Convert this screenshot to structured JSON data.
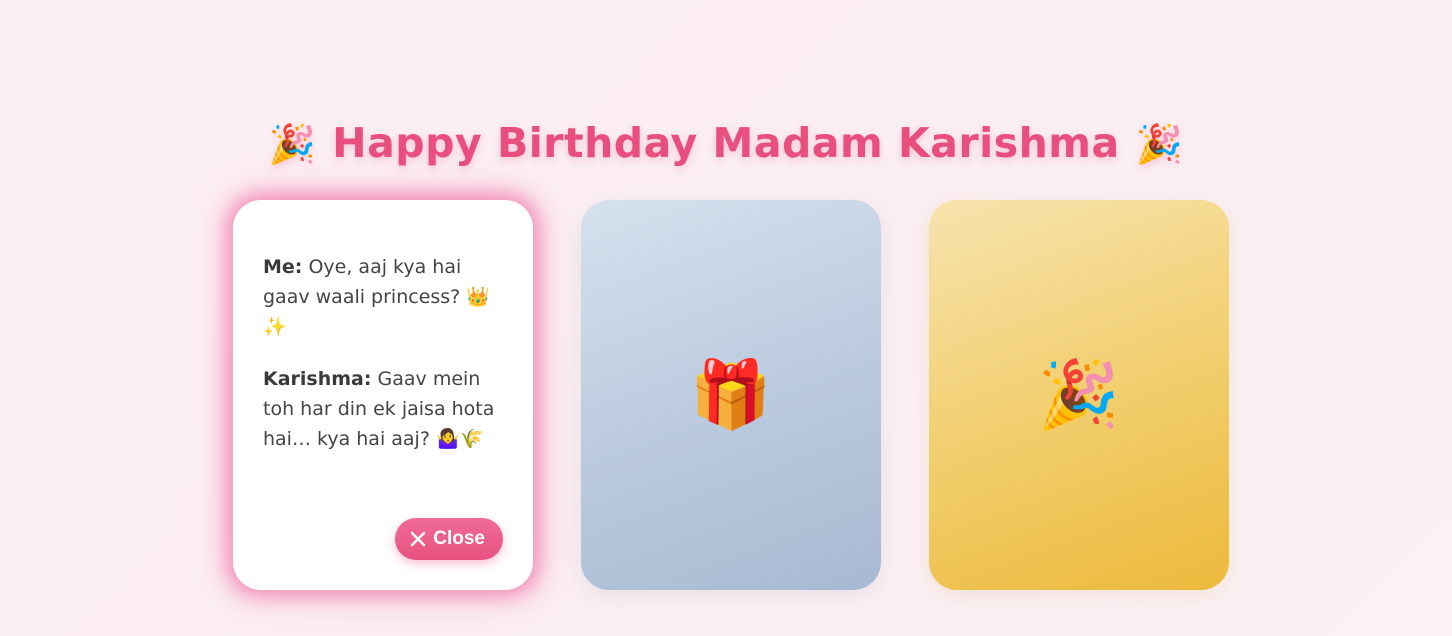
{
  "header": {
    "title": "Happy Birthday Madam Karishma",
    "left_emoji": "🎉",
    "right_emoji": "🎉"
  },
  "cards": [
    {
      "state": "open",
      "messages": [
        {
          "speaker": "Me:",
          "text": "Oye, aaj kya hai gaav waali princess? 👑✨"
        },
        {
          "speaker": "Karishma:",
          "text": "Gaav mein toh har din ek jaisa hota hai… kya hai aaj? 🤷‍♀️🌾"
        }
      ],
      "close_label": "Close"
    },
    {
      "state": "closed",
      "icon": "🎁",
      "icon_name": "gift-icon"
    },
    {
      "state": "closed",
      "icon": "🎉",
      "icon_name": "party-popper-icon"
    }
  ],
  "colors": {
    "accent": "#e84f7f",
    "background": "#fcf0f4",
    "gift_card": "#bccbdf",
    "party_card": "#f1cd6a"
  }
}
